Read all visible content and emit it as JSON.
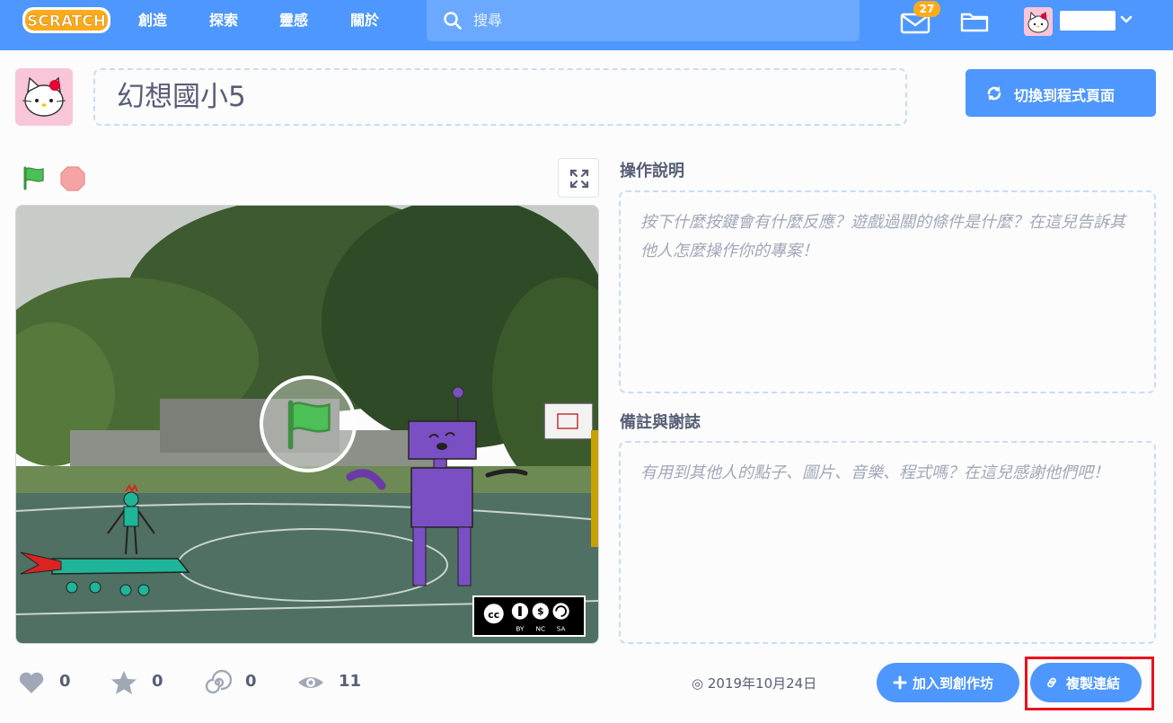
{
  "header": {
    "nav": [
      "創造",
      "探索",
      "靈感",
      "關於"
    ],
    "search_placeholder": "搜尋",
    "messages_count": "27"
  },
  "project": {
    "title": "幻想國小5",
    "see_inside_label": "切換到程式頁面"
  },
  "instructions": {
    "label": "操作說明",
    "placeholder": "按下什麼按鍵會有什麼反應？遊戲過關的條件是什麼？在這兒告訴其他人怎麼操作你的專案！"
  },
  "notes": {
    "label": "備註與謝誌",
    "placeholder": "有用到其他人的點子、圖片、音樂、程式嗎？在這兒感謝他們吧！"
  },
  "stats": {
    "loves": "0",
    "favorites": "0",
    "remixes": "0",
    "views": "11"
  },
  "share_date": "2019年10月24日",
  "buttons": {
    "add_to_studio": "加入到創作坊",
    "copy_link": "複製連結"
  },
  "cc_license": [
    "BY",
    "NC",
    "SA"
  ],
  "colors": {
    "brand_blue": "#4d97ff",
    "flag_green": "#4cbf56",
    "stop_red": "#f5a3a3",
    "highlight_red": "#e8121b"
  }
}
